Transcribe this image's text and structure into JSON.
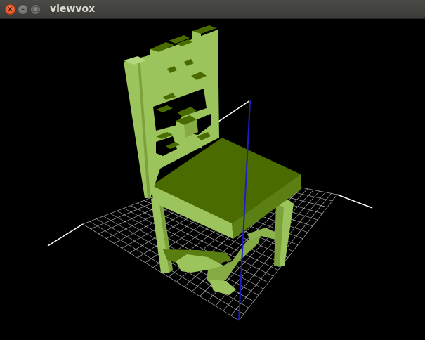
{
  "window": {
    "title": "viewvox",
    "close_glyph": "×",
    "minimize_glyph": "–",
    "maximize_glyph": "□"
  },
  "scene": {
    "object": "chair-voxel-model",
    "colors": {
      "voxel_light": "#9bc45c",
      "voxel_mid": "#7da23c",
      "voxel_dark": "#4a6b00",
      "voxel_shadow": "#3d5a00",
      "grid": "#c8c8c8",
      "axis_x": "#ffffff",
      "axis_y": "#ffffff",
      "axis_z": "#1e1ec8",
      "background": "#000000"
    }
  }
}
